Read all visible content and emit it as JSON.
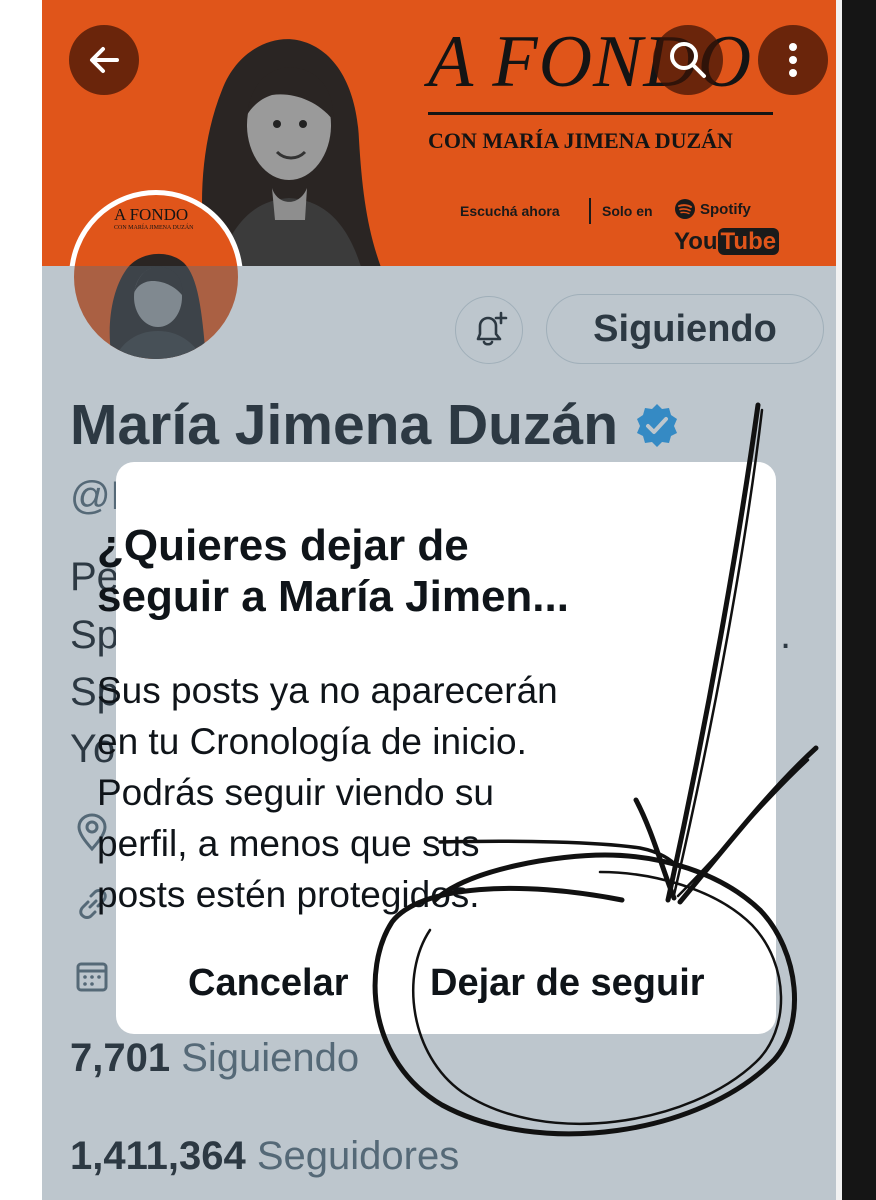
{
  "banner": {
    "title": "A FONDO",
    "subtitle": "CON MARÍA JIMENA DUZÁN",
    "listen": "Escuchá ahora",
    "solo": "Solo en",
    "spotify": "Spotify",
    "youtube_1": "You",
    "youtube_2": "Tube",
    "color": "#e0551a"
  },
  "avatar": {
    "title": "A FONDO",
    "subtitle": "CON MARÍA JIMENA DUZÁN"
  },
  "header": {
    "back_icon": "arrow-left-icon",
    "search_icon": "search-icon",
    "more_icon": "more-vertical-icon"
  },
  "profile": {
    "follow_state": "Siguiendo",
    "name": "María Jimena Duzán",
    "handle_partial": "@M",
    "bio_partial": [
      "Pe",
      "Sp",
      "Sp",
      "Yo"
    ],
    "bio_trailing": ".",
    "following_count": "7,701",
    "following_label": "Siguiendo",
    "followers_count": "1,411,364",
    "followers_label": "Seguidores"
  },
  "dialog": {
    "title_line1": "¿Quieres dejar de",
    "title_line2": "seguir a María Jimen...",
    "body_line1": "Sus posts ya no aparecerán",
    "body_line2": "en tu Cronología de inicio.",
    "body_line3": "Podrás seguir viendo su",
    "body_line4": "perfil, a menos que sus",
    "body_line5": "posts estén protegidos.",
    "cancel_label": "Cancelar",
    "unfollow_label": "Dejar de seguir"
  },
  "colors": {
    "accent": "#1d9bf0",
    "text": "#0f1419",
    "muted": "#536471",
    "overlay": "rgba(91,112,131,0.40)"
  }
}
